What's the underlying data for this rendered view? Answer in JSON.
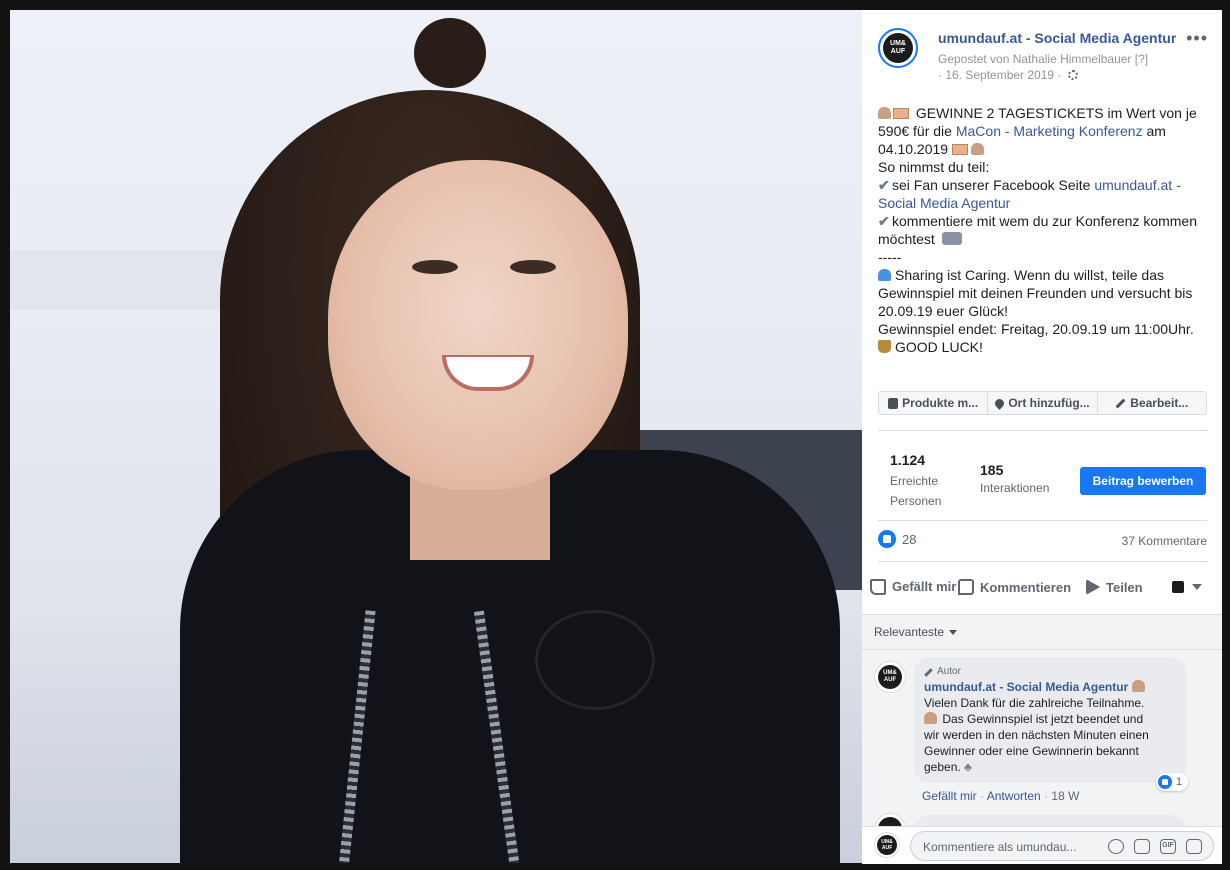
{
  "post": {
    "page_name": "umundauf.at - Social Media Agentur",
    "posted_by": "Gepostet von Nathalie Himmelbauer",
    "posted_by_hint": "[?]",
    "date": "· 16. September 2019 ·",
    "more": "•••",
    "avatar_text": "UM& AUF",
    "text_lines": [
      " GEWINNE 2 TAGESTICKETS im Wert von je",
      "590€ für die ",
      "MaCon - Marketing Konferenz",
      " am",
      "04.10.2019 ",
      "So nimmst du teil:",
      "sei Fan unserer Facebook Seite ",
      "umundauf.at -",
      "Social Media Agentur",
      "kommentiere mit wem du zur Konferenz kommen",
      "möchtest ",
      "-----",
      "Sharing ist Caring. Wenn du willst, teile das",
      "Gewinnspiel mit deinen Freunden und versucht bis",
      "20.09.19 euer Glück!",
      "Gewinnspiel endet: Freitag, 20.09.19 um 11:00Uhr.",
      "GOOD LUCK!"
    ]
  },
  "tag_bar": {
    "products": "Produkte m...",
    "location": "Ort hinzufüg...",
    "edit": "Bearbeit..."
  },
  "insights": {
    "reach_value": "1.124",
    "reach_label": "Erreichte Personen",
    "interactions_value": "185",
    "interactions_label": "Interaktionen",
    "boost_label": "Beitrag bewerben"
  },
  "reactions": {
    "count": "28",
    "comments": "37 Kommentare"
  },
  "actions": {
    "like": "Gefällt mir",
    "comment": "Kommentieren",
    "share": "Teilen"
  },
  "comments": {
    "sort_label": "Relevanteste",
    "items": [
      {
        "author_tag": "Autor",
        "name": "umundauf.at - Social Media Agentur",
        "lines": [
          "Vielen Dank für die zahlreiche Teilnahme.",
          " Das Gewinnspiel ist jetzt beendet und",
          "wir werden in den nächsten Minuten einen",
          "Gewinner oder eine Gewinnerin bekannt",
          "geben. "
        ],
        "likes": "1",
        "like_action": "Gefällt mir",
        "reply_action": "Antworten",
        "time": "18 W"
      }
    ],
    "compose_placeholder": "Kommentiere als umundau..."
  },
  "colors": {
    "link": "#385898",
    "primary": "#1877f2",
    "muted": "#606770"
  }
}
